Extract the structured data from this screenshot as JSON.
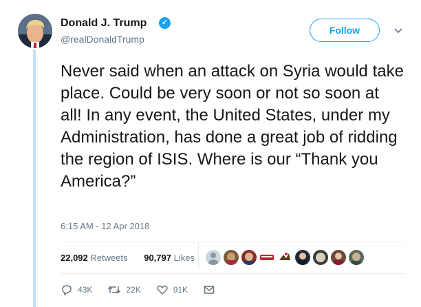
{
  "author": {
    "name": "Donald J. Trump",
    "handle": "@realDonaldTrump",
    "verified_icon": "verified-badge-icon"
  },
  "follow_label": "Follow",
  "tweet": {
    "text": "Never said when an attack on Syria would take place. Could be very soon or not so soon at all! In any event, the United States, under my Administration, has done a great job of ridding the region of ISIS. Where is our “Thank you America?”",
    "timestamp": "6:15 AM - 12 Apr 2018"
  },
  "stats": {
    "retweets_count": "22,092",
    "retweets_label": "Retweets",
    "likes_count": "90,797",
    "likes_label": "Likes"
  },
  "actions": {
    "replies": "43K",
    "retweets": "22K",
    "likes": "91K"
  },
  "colors": {
    "accent": "#1da1f2",
    "muted": "#657786"
  }
}
